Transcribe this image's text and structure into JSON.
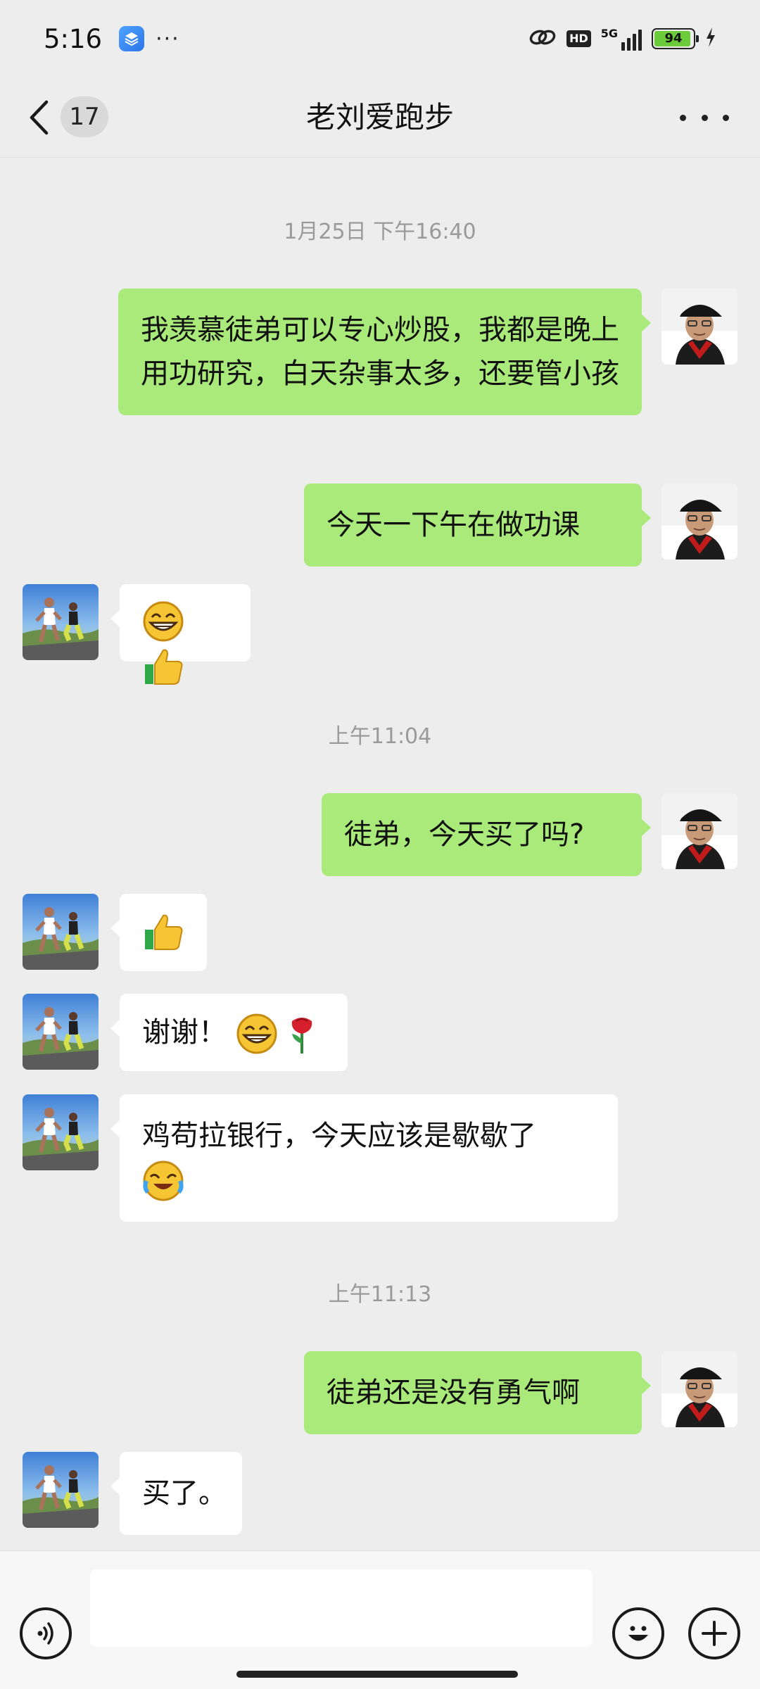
{
  "status_bar": {
    "time": "5:16",
    "dots": "···",
    "hd": "HD",
    "network": "5G",
    "battery": "94",
    "icons": [
      "app-icon",
      "link-icon",
      "signal-icon",
      "battery-icon",
      "charging-icon"
    ]
  },
  "header": {
    "title": "老刘爱跑步",
    "unread_count": "17",
    "icons": [
      "back-icon",
      "more-icon"
    ]
  },
  "messages": [
    {
      "type": "timestamp",
      "text": "1月25日 下午16:40"
    },
    {
      "type": "msg",
      "from": "me",
      "text": "我羡慕徒弟可以专心炒股，我都是晚上用功研究，白天杂事太多，还要管小孩"
    },
    {
      "type": "msg",
      "from": "me",
      "text": "今天一下午在做功课"
    },
    {
      "type": "msg",
      "from": "them",
      "text": "",
      "emojis": [
        "grin-emoji",
        "thumbs-up-emoji"
      ]
    },
    {
      "type": "timestamp",
      "text": "上午11:04"
    },
    {
      "type": "msg",
      "from": "me",
      "text": "徒弟，今天买了吗?"
    },
    {
      "type": "msg",
      "from": "them",
      "text": "",
      "emojis": [
        "thumbs-up-emoji"
      ]
    },
    {
      "type": "msg",
      "from": "them",
      "text": "谢谢！",
      "emojis": [
        "grin-emoji",
        "rose-emoji"
      ]
    },
    {
      "type": "msg",
      "from": "them",
      "text": "鸡苟拉银行，今天应该是歇歇了",
      "emojis": [
        "laugh-cry-emoji"
      ]
    },
    {
      "type": "timestamp",
      "text": "上午11:13"
    },
    {
      "type": "msg",
      "from": "me",
      "text": "徒弟还是没有勇气啊"
    },
    {
      "type": "msg",
      "from": "them",
      "text": "买了。"
    }
  ],
  "input_bar": {
    "value": "",
    "icons": [
      "voice-icon",
      "emoji-icon",
      "plus-icon"
    ]
  },
  "colors": {
    "background": "#ededed",
    "my_bubble": "#a9ea7a",
    "their_bubble": "#ffffff",
    "timestamp_text": "#9a9a9a"
  }
}
